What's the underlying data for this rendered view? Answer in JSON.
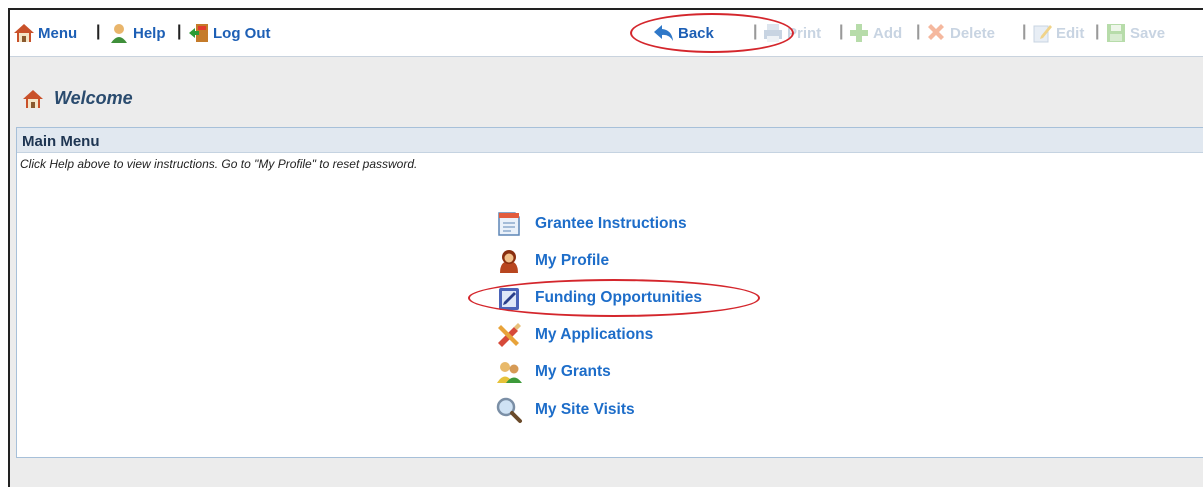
{
  "toolbar": {
    "menu_label": "Menu",
    "help_label": "Help",
    "logout_label": "Log Out",
    "back_label": "Back",
    "print_label": "Print",
    "add_label": "Add",
    "delete_label": "Delete",
    "edit_label": "Edit",
    "save_label": "Save",
    "separator": "|"
  },
  "welcome": {
    "title": "Welcome"
  },
  "main_menu": {
    "title": "Main Menu",
    "instructions": "Click Help above to view instructions. Go to \"My Profile\" to reset password.",
    "items": [
      {
        "label": "Grantee Instructions",
        "icon": "document-icon"
      },
      {
        "label": "My Profile",
        "icon": "user-icon"
      },
      {
        "label": "Funding Opportunities",
        "icon": "clipboard-icon"
      },
      {
        "label": "My Applications",
        "icon": "tools-icon"
      },
      {
        "label": "My Grants",
        "icon": "people-icon"
      },
      {
        "label": "My Site Visits",
        "icon": "magnifier-icon"
      }
    ]
  },
  "colors": {
    "link": "#1d6dc9",
    "annotation": "#d4262c",
    "disabled": "#c8d4e2"
  }
}
